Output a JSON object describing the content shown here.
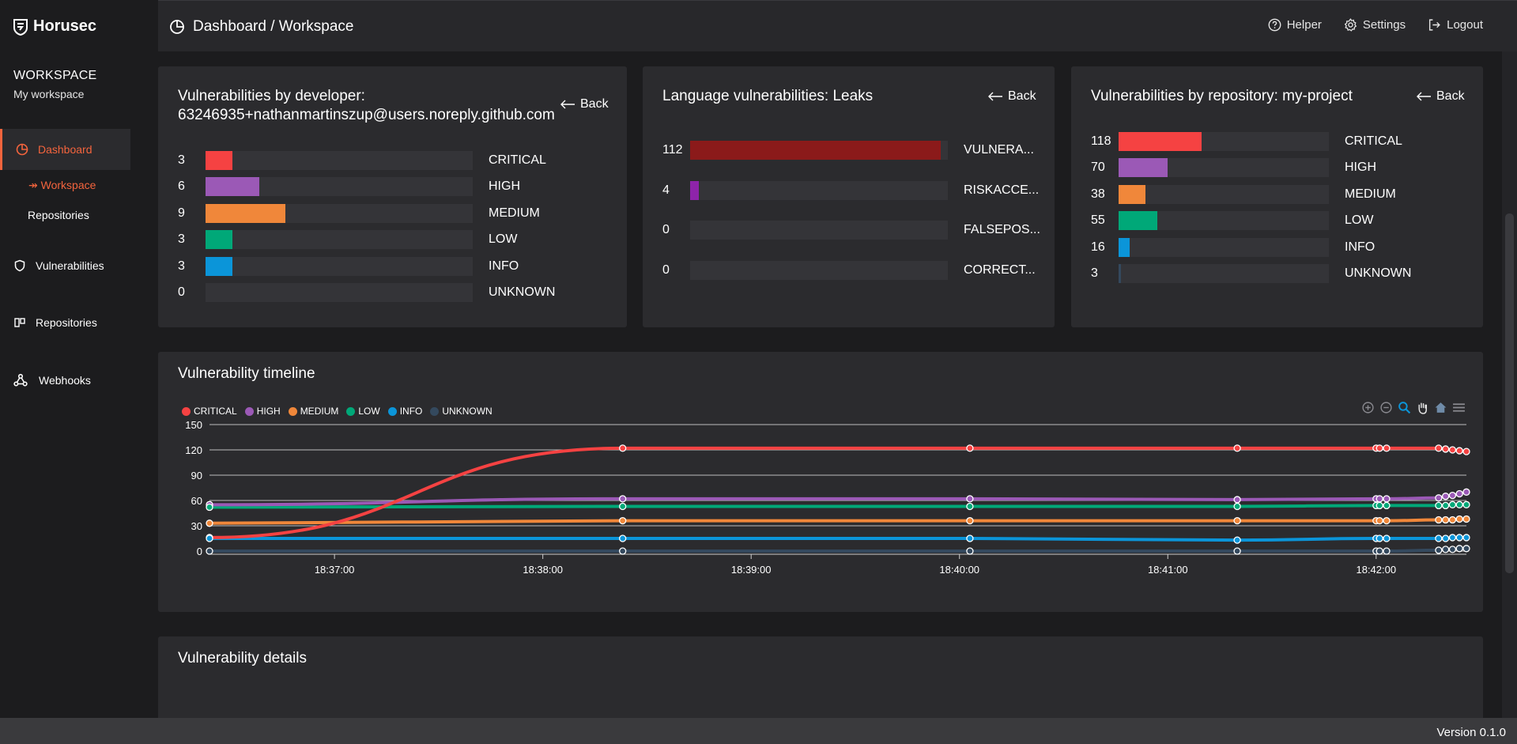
{
  "app": {
    "name": "Horusec",
    "version": "Version 0.1.0"
  },
  "sidebar": {
    "workspace_title": "WORKSPACE",
    "workspace_name": "My workspace",
    "nav": [
      {
        "label": "Dashboard",
        "icon": "pie-chart-icon",
        "active": true
      },
      {
        "label": "Vulnerabilities",
        "icon": "shield-icon"
      },
      {
        "label": "Repositories",
        "icon": "repository-icon"
      },
      {
        "label": "Webhooks",
        "icon": "webhook-icon"
      }
    ],
    "sub_nav": [
      {
        "label": "↠ Workspace",
        "active": true
      },
      {
        "label": "Repositories"
      }
    ]
  },
  "header": {
    "breadcrumb": "Dashboard / Workspace",
    "actions": [
      {
        "label": "Helper",
        "icon": "help-icon"
      },
      {
        "label": "Settings",
        "icon": "gear-icon"
      },
      {
        "label": "Logout",
        "icon": "logout-icon"
      }
    ]
  },
  "colors": {
    "accent": "#f4643d",
    "critical": "#f54242",
    "high": "#9b59b6",
    "medium": "#f0873a",
    "low": "#00a878",
    "info": "#0b95d9",
    "unknown": "#34495e",
    "leak_vuln": "#8b1a1a",
    "leak_risk": "#8e24aa"
  },
  "cards": {
    "developer": {
      "title": "Vulnerabilities by developer:",
      "subtitle": "63246935+nathanmartinszup@users.noreply.github.com",
      "back": "Back",
      "max": 30,
      "rows": [
        {
          "value": 3,
          "label": "CRITICAL",
          "color": "#f54242"
        },
        {
          "value": 6,
          "label": "HIGH",
          "color": "#9b59b6"
        },
        {
          "value": 9,
          "label": "MEDIUM",
          "color": "#f0873a"
        },
        {
          "value": 3,
          "label": "LOW",
          "color": "#00a878"
        },
        {
          "value": 3,
          "label": "INFO",
          "color": "#0b95d9"
        },
        {
          "value": 0,
          "label": "UNKNOWN",
          "color": "#34495e"
        }
      ]
    },
    "language": {
      "title": "Language vulnerabilities: Leaks",
      "back": "Back",
      "max": 115,
      "rows": [
        {
          "value": 112,
          "label": "VULNERA...",
          "color": "#8b1a1a"
        },
        {
          "value": 4,
          "label": "RISKACCE...",
          "color": "#8e24aa"
        },
        {
          "value": 0,
          "label": "FALSEPOS...",
          "color": "#34495e"
        },
        {
          "value": 0,
          "label": "CORRECT...",
          "color": "#34495e"
        }
      ]
    },
    "repository": {
      "title": "Vulnerabilities by repository: my-project",
      "back": "Back",
      "max": 300,
      "rows": [
        {
          "value": 118,
          "label": "CRITICAL",
          "color": "#f54242"
        },
        {
          "value": 70,
          "label": "HIGH",
          "color": "#9b59b6"
        },
        {
          "value": 38,
          "label": "MEDIUM",
          "color": "#f0873a"
        },
        {
          "value": 55,
          "label": "LOW",
          "color": "#00a878"
        },
        {
          "value": 16,
          "label": "INFO",
          "color": "#0b95d9"
        },
        {
          "value": 3,
          "label": "UNKNOWN",
          "color": "#34495e"
        }
      ]
    },
    "timeline": {
      "title": "Vulnerability timeline",
      "tools": [
        "zoom-in-icon",
        "zoom-out-icon",
        "selection-zoom-icon",
        "pan-icon",
        "home-icon",
        "menu-icon"
      ]
    },
    "details": {
      "title": "Vulnerability details"
    }
  },
  "chart_data": {
    "type": "line",
    "title": "Vulnerability timeline",
    "ylim": [
      0,
      150
    ],
    "y_ticks": [
      "0",
      "30",
      "60",
      "90",
      "120",
      "150"
    ],
    "x_ticks": [
      "18:37:00",
      "18:38:00",
      "18:39:00",
      "18:40:00",
      "18:41:00",
      "18:42:00"
    ],
    "xlim": [
      "18:36:24",
      "18:42:26"
    ],
    "legend_position": "top-left",
    "grid": true,
    "x": [
      "18:36:24",
      "18:38:23",
      "18:40:03",
      "18:41:20",
      "18:42:00",
      "18:42:01",
      "18:42:03",
      "18:42:18",
      "18:42:20",
      "18:42:22",
      "18:42:24",
      "18:42:26"
    ],
    "series": [
      {
        "name": "CRITICAL",
        "color": "#f54242",
        "values": [
          16,
          122,
          122,
          122,
          122,
          122,
          122,
          122,
          121,
          120,
          119,
          118
        ]
      },
      {
        "name": "HIGH",
        "color": "#9b59b6",
        "values": [
          55,
          62,
          62,
          61,
          62,
          62,
          62,
          63,
          65,
          66,
          68,
          70
        ]
      },
      {
        "name": "MEDIUM",
        "color": "#f0873a",
        "values": [
          33,
          36,
          36,
          36,
          36,
          36,
          36,
          37,
          37,
          37,
          38,
          38
        ]
      },
      {
        "name": "LOW",
        "color": "#00a878",
        "values": [
          52,
          53,
          53,
          53,
          54,
          54,
          54,
          54,
          54,
          55,
          55,
          55
        ]
      },
      {
        "name": "INFO",
        "color": "#0b95d9",
        "values": [
          15,
          15,
          15,
          13,
          15,
          15,
          15,
          15,
          15,
          16,
          16,
          16
        ]
      },
      {
        "name": "UNKNOWN",
        "color": "#34495e",
        "values": [
          0,
          0,
          0,
          0,
          0,
          0,
          0,
          1,
          2,
          2,
          3,
          3
        ]
      }
    ]
  }
}
